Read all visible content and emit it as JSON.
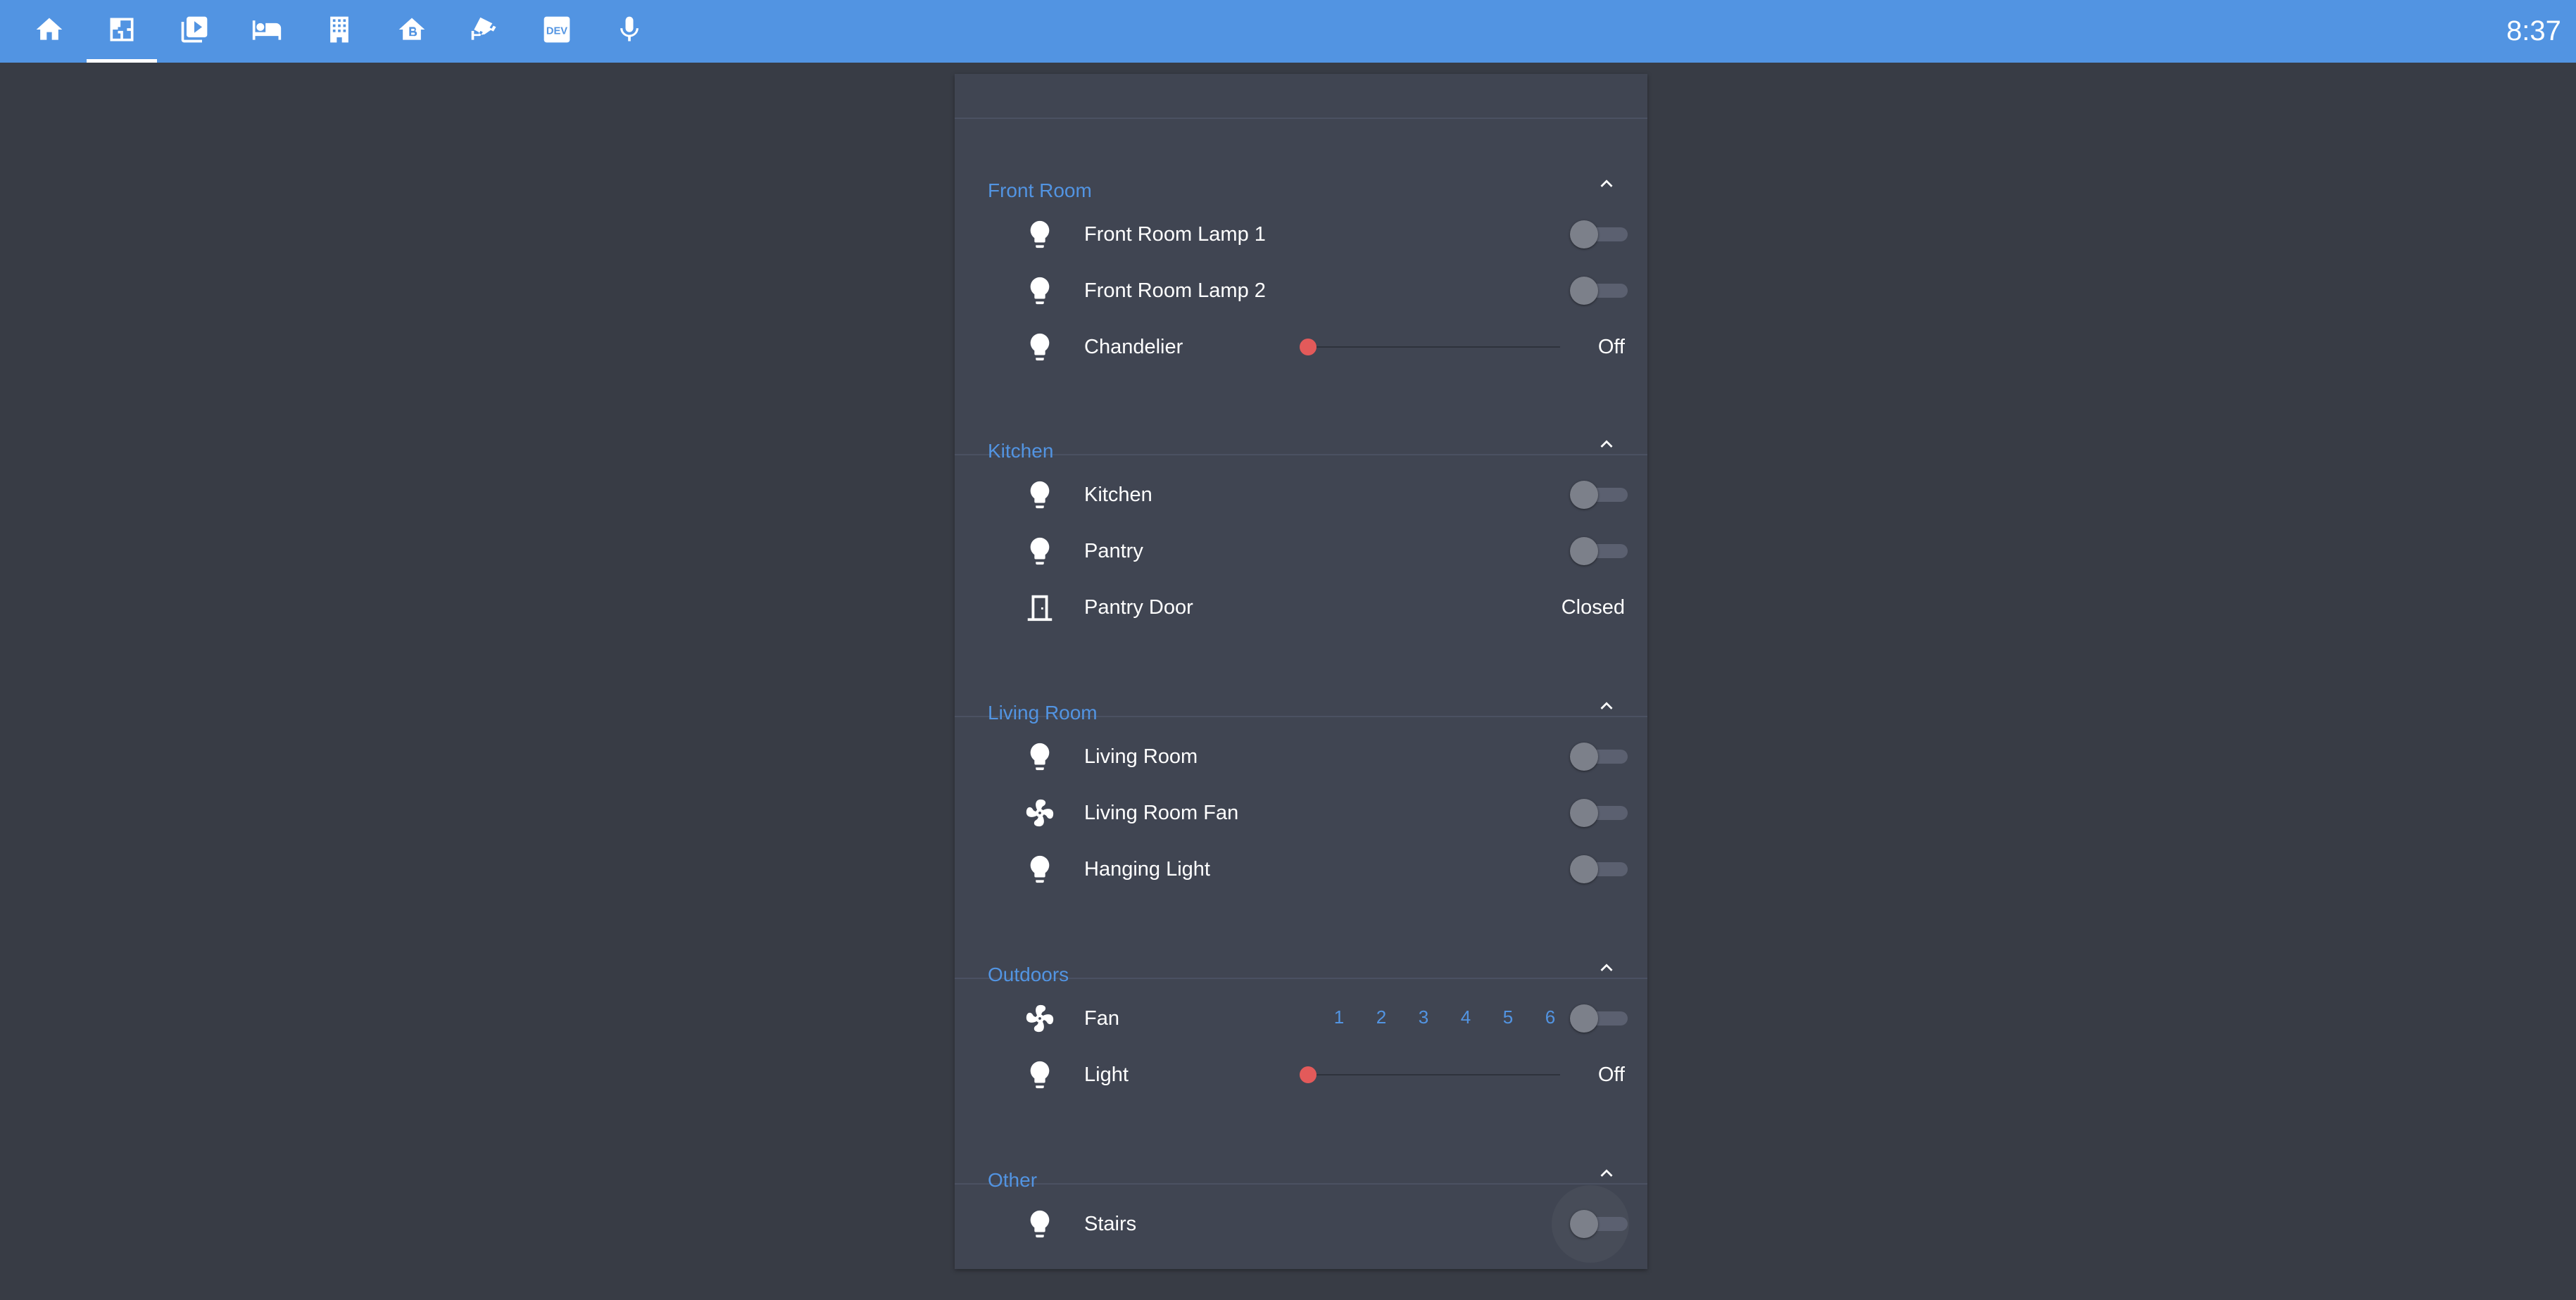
{
  "toolbar": {
    "tabs": [
      {
        "icon": "home-icon"
      },
      {
        "icon": "floorplan-icon"
      },
      {
        "icon": "media-library-icon"
      },
      {
        "icon": "bed-icon"
      },
      {
        "icon": "building-icon"
      },
      {
        "icon": "bitcoin-home-icon"
      },
      {
        "icon": "cctv-icon"
      },
      {
        "icon": "dev-icon",
        "text": "DEV"
      },
      {
        "icon": "microphone-icon"
      }
    ],
    "active_index": 1,
    "clock": "8:37"
  },
  "colors": {
    "header": "#5294e2",
    "background": "#383c45",
    "card": "#404552",
    "accent": "#5294e2",
    "slider_knob": "#e35a5a"
  },
  "groups": [
    {
      "title": "Front Room",
      "rows": [
        {
          "label": "Front Room Lamp 1",
          "icon": "lightbulb-icon",
          "control": "toggle",
          "on": false
        },
        {
          "label": "Front Room Lamp 2",
          "icon": "lightbulb-icon",
          "control": "toggle",
          "on": false
        },
        {
          "label": "Chandelier",
          "icon": "lightbulb-icon",
          "control": "slider",
          "brightness": 0,
          "state": "Off"
        }
      ]
    },
    {
      "title": "Kitchen",
      "rows": [
        {
          "label": "Kitchen",
          "icon": "lightbulb-icon",
          "control": "toggle",
          "on": false
        },
        {
          "label": "Pantry",
          "icon": "lightbulb-icon",
          "control": "toggle",
          "on": false
        },
        {
          "label": "Pantry Door",
          "icon": "door-icon",
          "control": "state",
          "state": "Closed"
        }
      ]
    },
    {
      "title": "Living Room",
      "rows": [
        {
          "label": "Living Room",
          "icon": "lightbulb-icon",
          "control": "toggle",
          "on": false
        },
        {
          "label": "Living Room Fan",
          "icon": "fan-icon",
          "control": "toggle",
          "on": false
        },
        {
          "label": "Hanging Light",
          "icon": "lightbulb-icon",
          "control": "toggle",
          "on": false
        }
      ]
    },
    {
      "title": "Outdoors",
      "rows": [
        {
          "label": "Fan",
          "icon": "fan-icon",
          "control": "fan",
          "speeds": [
            "1",
            "2",
            "3",
            "4",
            "5",
            "6"
          ],
          "on": false
        },
        {
          "label": "Light",
          "icon": "lightbulb-icon",
          "control": "slider",
          "brightness": 0,
          "state": "Off"
        }
      ]
    },
    {
      "title": "Other",
      "rows": [
        {
          "label": "Stairs",
          "icon": "lightbulb-icon",
          "control": "toggle",
          "on": false,
          "focused": true
        }
      ]
    }
  ]
}
